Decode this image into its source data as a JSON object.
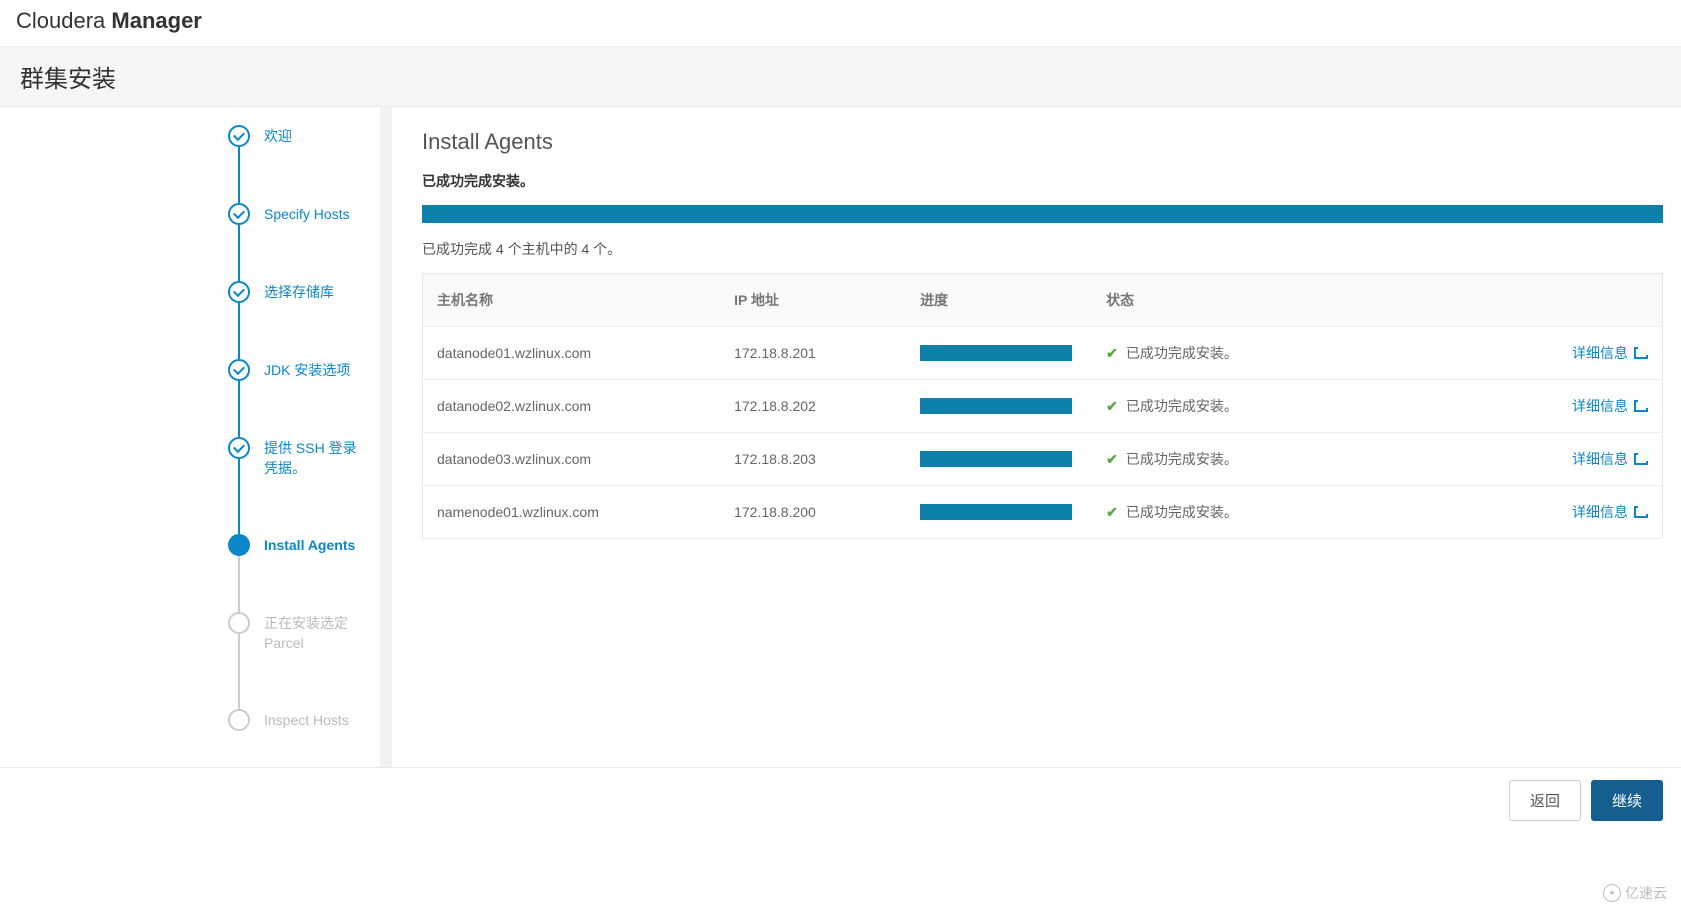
{
  "brand": {
    "first": "Cloudera ",
    "second": "Manager"
  },
  "pageTitle": "群集安装",
  "wizard": {
    "steps": [
      {
        "label": "欢迎",
        "state": "done"
      },
      {
        "label": "Specify Hosts",
        "state": "done"
      },
      {
        "label": "选择存储库",
        "state": "done"
      },
      {
        "label": "JDK 安装选项",
        "state": "done"
      },
      {
        "label": "提供 SSH 登录凭据。",
        "state": "done"
      },
      {
        "label": "Install Agents",
        "state": "active"
      },
      {
        "label": "正在安装选定 Parcel",
        "state": "pending"
      },
      {
        "label": "Inspect Hosts",
        "state": "pending"
      }
    ]
  },
  "content": {
    "title": "Install Agents",
    "successMsg": "已成功完成安装。",
    "summary": "已成功完成 4 个主机中的 4 个。",
    "columns": {
      "host": "主机名称",
      "ip": "IP 地址",
      "progress": "进度",
      "status": "状态"
    },
    "detailLabel": "详细信息",
    "statusOk": "已成功完成安装。",
    "rows": [
      {
        "host": "datanode01.wzlinux.com",
        "ip": "172.18.8.201"
      },
      {
        "host": "datanode02.wzlinux.com",
        "ip": "172.18.8.202"
      },
      {
        "host": "datanode03.wzlinux.com",
        "ip": "172.18.8.203"
      },
      {
        "host": "namenode01.wzlinux.com",
        "ip": "172.18.8.200"
      }
    ]
  },
  "footer": {
    "back": "返回",
    "continue": "继续"
  },
  "watermark": "亿速云"
}
